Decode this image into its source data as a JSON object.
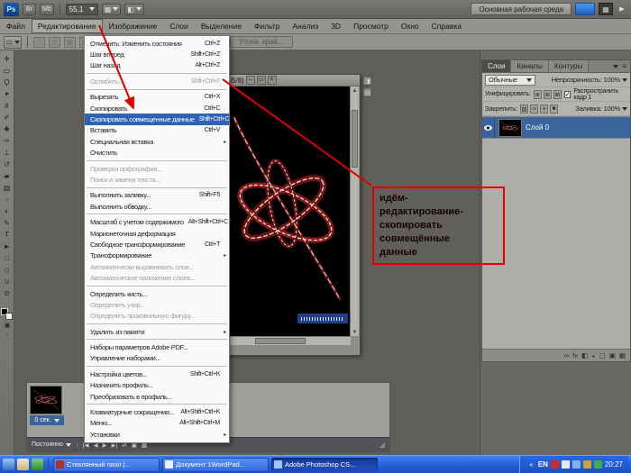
{
  "topbar": {
    "logo": "Ps",
    "bridge": "Br",
    "minibridge": "Mb",
    "zoom": "55,1",
    "workspace": "Основная рабочая среда"
  },
  "menubar": {
    "items": [
      {
        "label": "Файл"
      },
      {
        "label": "Редактирование",
        "active": true
      },
      {
        "label": "Изображение"
      },
      {
        "label": "Слои"
      },
      {
        "label": "Выделение"
      },
      {
        "label": "Фильтр"
      },
      {
        "label": "Анализ"
      },
      {
        "label": "3D"
      },
      {
        "label": "Просмотр"
      },
      {
        "label": "Окно"
      },
      {
        "label": "Справка"
      }
    ]
  },
  "options_bar": {
    "refine_edge": "Уточн. край..."
  },
  "edit_menu": {
    "items": [
      {
        "label": "Отменить: Изменить состояния",
        "shortcut": "Ctrl+Z"
      },
      {
        "label": "Шаг вперед",
        "shortcut": "Shift+Ctrl+Z"
      },
      {
        "label": "Шаг назад",
        "shortcut": "Alt+Ctrl+Z"
      },
      {
        "separator": true
      },
      {
        "label": "Ослабить...",
        "shortcut": "Shift+Ctrl+F",
        "disabled": true
      },
      {
        "separator": true
      },
      {
        "label": "Вырезать",
        "shortcut": "Ctrl+X"
      },
      {
        "label": "Скопировать",
        "shortcut": "Ctrl+C"
      },
      {
        "label": "Скопировать совмещенные данные",
        "shortcut": "Shift+Ctrl+C",
        "highlighted": true
      },
      {
        "label": "Вставить",
        "shortcut": "Ctrl+V"
      },
      {
        "label": "Специальная вставка",
        "submenu": true
      },
      {
        "label": "Очистить"
      },
      {
        "separator": true
      },
      {
        "label": "Проверка орфографии...",
        "disabled": true
      },
      {
        "label": "Поиск и замена текста...",
        "disabled": true
      },
      {
        "separator": true
      },
      {
        "label": "Выполнить заливку...",
        "shortcut": "Shift+F5"
      },
      {
        "label": "Выполнить обводку..."
      },
      {
        "separator": true
      },
      {
        "label": "Масштаб с учетом содержимого",
        "shortcut": "Alt+Shift+Ctrl+C"
      },
      {
        "label": "Марионеточная деформация"
      },
      {
        "label": "Свободное трансформирование",
        "shortcut": "Ctrl+T"
      },
      {
        "label": "Трансформирование",
        "submenu": true
      },
      {
        "label": "Автоматически выравнивать слои...",
        "disabled": true
      },
      {
        "label": "Автоматическое наложение слоев...",
        "disabled": true
      },
      {
        "separator": true
      },
      {
        "label": "Определить кисть..."
      },
      {
        "label": "Определить узор...",
        "disabled": true
      },
      {
        "label": "Определить произвольную фигуру...",
        "disabled": true
      },
      {
        "separator": true
      },
      {
        "label": "Удалить из памяти",
        "submenu": true
      },
      {
        "separator": true
      },
      {
        "label": "Наборы параметров Adobe PDF..."
      },
      {
        "label": "Управление наборами..."
      },
      {
        "separator": true
      },
      {
        "label": "Настройка цветов...",
        "shortcut": "Shift+Ctrl+K"
      },
      {
        "label": "Назначить профиль..."
      },
      {
        "label": "Преобразовать в профиль..."
      },
      {
        "separator": true
      },
      {
        "label": "Клавиатурные сокращения...",
        "shortcut": "Alt+Shift+Ctrl+K"
      },
      {
        "label": "Меню...",
        "shortcut": "Alt+Shift+Ctrl+M"
      },
      {
        "label": "Установки",
        "submenu": true
      }
    ]
  },
  "document_window": {
    "title": "(GB/8)"
  },
  "annotation": {
    "lines": [
      "идём-",
      "редактирование-",
      "скопировать",
      "совмещённые",
      "данные"
    ]
  },
  "panels": {
    "tabs": [
      {
        "label": "Слои",
        "active": true
      },
      {
        "label": "Каналы"
      },
      {
        "label": "Контуры"
      }
    ],
    "blend_mode": "Обычные",
    "opacity_label": "Непрозрачность:",
    "opacity_value": "100%",
    "unify_label": "Унифицировать:",
    "unify_icons": [
      {
        "name": "unify-position-icon",
        "glyph": "⊕"
      },
      {
        "name": "unify-visibility-icon",
        "glyph": "⊞"
      },
      {
        "name": "unify-style-icon",
        "glyph": "⊠"
      }
    ],
    "propagate_checkbox": "Распространить кадр 1",
    "lock_label": "Закрепить:",
    "lock_icons": [
      {
        "name": "lock-transparency-icon",
        "glyph": "▨"
      },
      {
        "name": "lock-pixels-icon",
        "glyph": "✑"
      },
      {
        "name": "lock-position-icon",
        "glyph": "✛"
      },
      {
        "name": "lock-all-icon",
        "glyph": "■"
      }
    ],
    "fill_label": "Заливка:",
    "fill_value": "100%",
    "layer_name": "Слой 0",
    "footer_icons": [
      {
        "name": "link-layers-icon",
        "glyph": "∞"
      },
      {
        "name": "layer-style-icon",
        "glyph": "fx"
      },
      {
        "name": "layer-mask-icon",
        "glyph": "◧"
      },
      {
        "name": "adjustment-layer-icon",
        "glyph": "◒"
      },
      {
        "name": "new-group-icon",
        "glyph": "▢"
      },
      {
        "name": "new-layer-icon",
        "glyph": "▣"
      },
      {
        "name": "delete-layer-icon",
        "glyph": "▦"
      }
    ]
  },
  "animation": {
    "frame_delay": "0 сек.",
    "loop_option": "Постоянно",
    "transport_icons": [
      {
        "name": "first-frame-icon",
        "glyph": "|◀"
      },
      {
        "name": "previous-frame-icon",
        "glyph": "◀"
      },
      {
        "name": "play-icon",
        "glyph": "▶"
      },
      {
        "name": "next-frame-icon",
        "glyph": "▶|"
      },
      {
        "name": "tween-icon",
        "glyph": "⇄"
      },
      {
        "name": "duplicate-frame-icon",
        "glyph": "▣"
      },
      {
        "name": "delete-frame-icon",
        "glyph": "▦"
      }
    ]
  },
  "tools": [
    {
      "name": "move-tool",
      "glyph": "✛"
    },
    {
      "name": "marquee-tool",
      "glyph": "▭"
    },
    {
      "name": "lasso-tool",
      "glyph": "Ϙ"
    },
    {
      "name": "quick-selection-tool",
      "glyph": "✦"
    },
    {
      "name": "crop-tool",
      "glyph": "#"
    },
    {
      "name": "eyedropper-tool",
      "glyph": "✐"
    },
    {
      "name": "healing-brush-tool",
      "glyph": "✚"
    },
    {
      "name": "brush-tool",
      "glyph": "✑"
    },
    {
      "name": "clone-stamp-tool",
      "glyph": "⊥"
    },
    {
      "name": "history-brush-tool",
      "glyph": "↺"
    },
    {
      "name": "eraser-tool",
      "glyph": "▰"
    },
    {
      "name": "gradient-tool",
      "glyph": "▧"
    },
    {
      "name": "blur-tool",
      "glyph": "○"
    },
    {
      "name": "dodge-tool",
      "glyph": "◐"
    },
    {
      "name": "pen-tool",
      "glyph": "✎"
    },
    {
      "name": "type-tool",
      "glyph": "T"
    },
    {
      "name": "path-selection-tool",
      "glyph": "►"
    },
    {
      "name": "shape-tool",
      "glyph": "□"
    },
    {
      "name": "3d-rotate-tool",
      "glyph": "◇"
    },
    {
      "name": "hand-tool",
      "glyph": "∪"
    },
    {
      "name": "zoom-tool",
      "glyph": "⊙"
    }
  ],
  "icons": {
    "close": "×",
    "minimize": "–",
    "restore": "▭",
    "menu": "≡",
    "check": "✓",
    "collapsed_panel_1": "◨",
    "collapsed_panel_2": "▤",
    "scroll_up": "▲",
    "scroll_down": "▼",
    "grip": "◢"
  },
  "taskbar": {
    "tasks": [
      {
        "label": "Стеклянный пазл |...",
        "icon_color": "#b03030"
      },
      {
        "label": "Документ 1WordPad...",
        "icon_color": "#e8eef8"
      },
      {
        "label": "Adobe Photoshop CS...",
        "icon_color": "#9cc6ee",
        "active": true
      }
    ],
    "tray": {
      "language": "EN",
      "time": "20:27"
    }
  }
}
